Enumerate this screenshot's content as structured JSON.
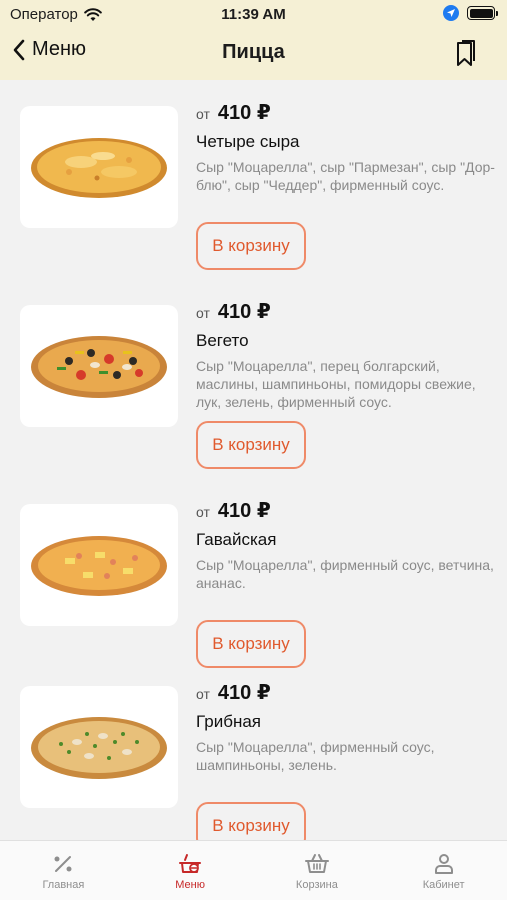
{
  "status_bar": {
    "carrier": "Оператор",
    "time": "11:39 AM"
  },
  "navbar": {
    "back_label": "Меню",
    "title": "Пицца"
  },
  "price_prefix": "от",
  "cart_label": "В корзину",
  "products": [
    {
      "price": "410 ₽",
      "name": "Четыре сыра",
      "description": "Сыр \"Моцарелла\", сыр \"Пармезан\", сыр \"Дор-блю\", сыр \"Чеддер\", фирменный соус."
    },
    {
      "price": "410 ₽",
      "name": "Вегето",
      "description": "Сыр \"Моцарелла\", перец болгарский, маслины, шампиньоны, помидоры свежие, лук, зелень, фирменный соус."
    },
    {
      "price": "410 ₽",
      "name": "Гавайская",
      "description": "Сыр \"Моцарелла\", фирменный соус, ветчина, ананас."
    },
    {
      "price": "410 ₽",
      "name": "Грибная",
      "description": "Сыр \"Моцарелла\", фирменный соус, шампиньоны, зелень."
    }
  ],
  "tabbar": {
    "items": [
      {
        "label": "Главная",
        "icon": "percent-icon"
      },
      {
        "label": "Меню",
        "icon": "menu-icon"
      },
      {
        "label": "Корзина",
        "icon": "basket-icon"
      },
      {
        "label": "Кабинет",
        "icon": "person-icon"
      }
    ],
    "active": "Меню"
  },
  "colors": {
    "header_bg": "#f5f0d5",
    "accent": "#e05a2e",
    "button_border": "#ef8a68",
    "active_tab": "#c62828"
  }
}
